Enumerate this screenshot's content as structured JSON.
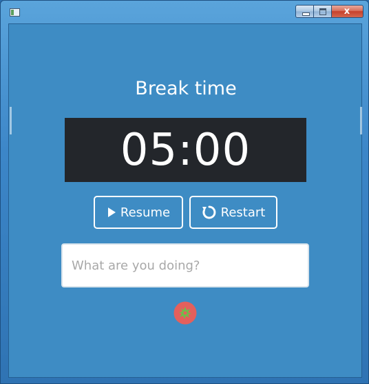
{
  "window": {
    "icon": "app-window-icon",
    "buttons": {
      "minimize": "minimize-icon",
      "maximize": "maximize-icon",
      "close_label": "x"
    }
  },
  "timer": {
    "mode_title": "Break time",
    "display": "05:00"
  },
  "controls": {
    "resume_label": "Resume",
    "restart_label": "Restart",
    "resume_icon": "play-icon",
    "restart_icon": "restart-icon"
  },
  "task": {
    "value": "",
    "placeholder": "What are you doing?"
  },
  "colors": {
    "background": "#3e8cc4",
    "timer_bg": "#23262b",
    "tomato": "#e4605c",
    "tomato_leaf": "#6cc04a"
  }
}
